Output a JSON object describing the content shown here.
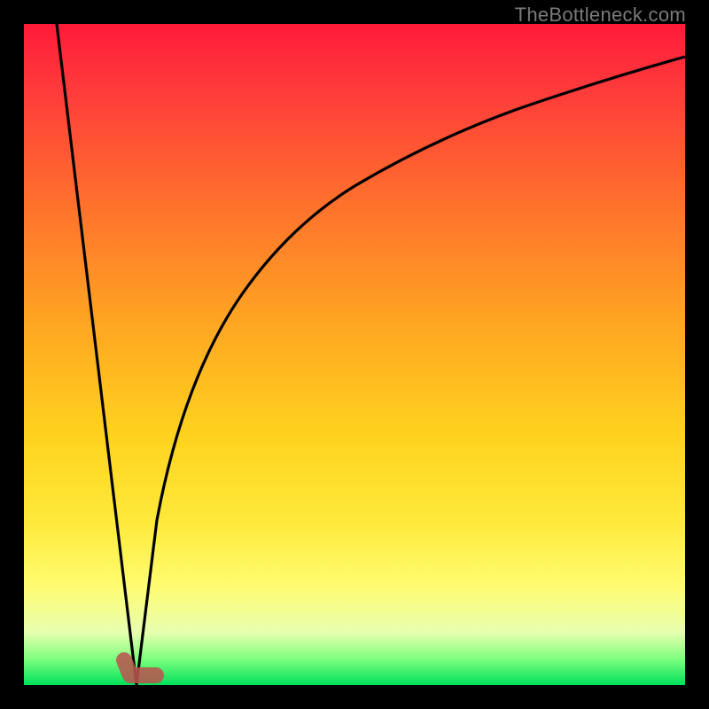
{
  "watermark": "TheBottleneck.com",
  "colors": {
    "frame_bg_start": "#ff1a3a",
    "frame_bg_end": "#00e05a",
    "curve": "#000000",
    "marker": "#b8574f",
    "page_bg": "#000000"
  },
  "chart_data": {
    "type": "line",
    "title": "",
    "xlabel": "",
    "ylabel": "",
    "xlim": [
      0,
      100
    ],
    "ylim": [
      0,
      100
    ],
    "series": [
      {
        "name": "left-branch",
        "x": [
          5,
          8,
          11,
          14,
          17
        ],
        "y": [
          100,
          75,
          50,
          25,
          0
        ]
      },
      {
        "name": "right-branch",
        "x": [
          17,
          20,
          24,
          28,
          33,
          40,
          48,
          58,
          70,
          84,
          100
        ],
        "y": [
          0,
          25,
          45,
          59,
          70,
          78,
          84,
          88,
          91.5,
          93.5,
          95
        ]
      }
    ],
    "annotations": [
      {
        "name": "minimum-marker",
        "x": 17,
        "y": 1.5
      }
    ]
  }
}
